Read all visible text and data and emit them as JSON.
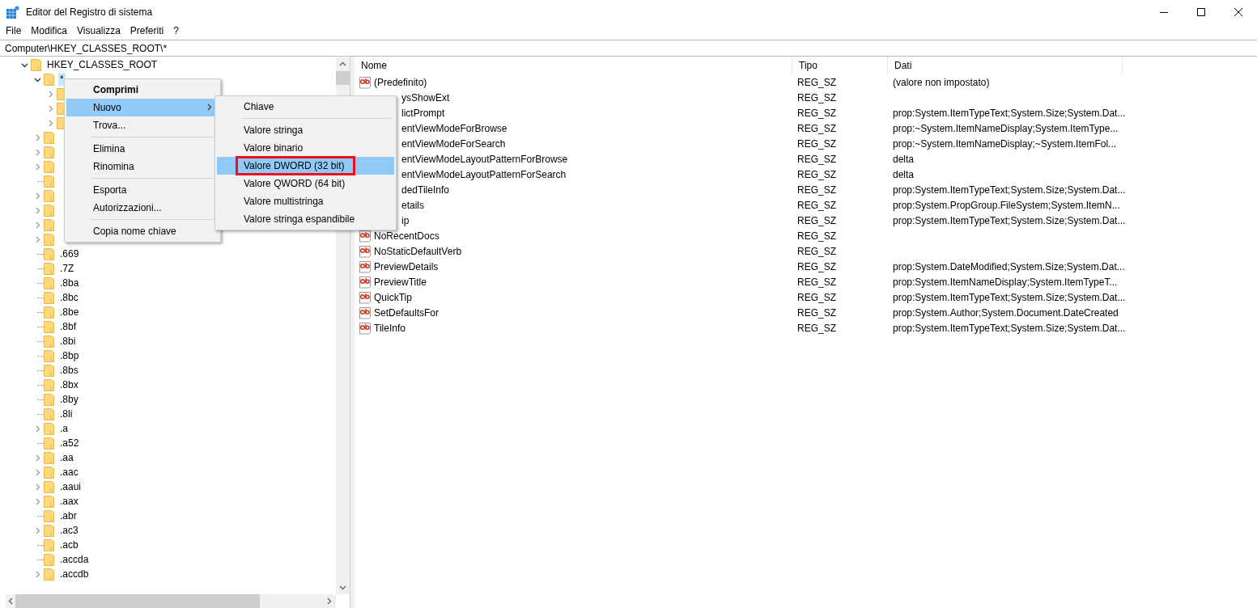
{
  "window": {
    "title": "Editor del Registro di sistema"
  },
  "menu_bar": [
    "File",
    "Modifica",
    "Visualizza",
    "Preferiti",
    "?"
  ],
  "address": {
    "value": "Computer\\HKEY_CLASSES_ROOT\\*"
  },
  "tree": [
    {
      "label": "HKEY_CLASSES_ROOT",
      "kind": "branch",
      "expanded": true,
      "selected": false,
      "children": [
        {
          "label": "*",
          "kind": "branch",
          "expanded": true,
          "selected": true,
          "children": [
            {
              "kind": "branch",
              "expanded": false,
              "selected": false
            },
            {
              "kind": "branch",
              "expanded": false,
              "selected": false
            },
            {
              "kind": "branch",
              "expanded": false,
              "selected": false
            }
          ]
        },
        {
          "kind": "branch",
          "expanded": false,
          "selected": false
        },
        {
          "kind": "branch",
          "expanded": false,
          "selected": false
        },
        {
          "kind": "branch",
          "expanded": false,
          "selected": false
        },
        {
          "kind": "leaf",
          "selected": false
        },
        {
          "kind": "branch",
          "expanded": false,
          "selected": false
        },
        {
          "kind": "branch",
          "expanded": false,
          "selected": false
        },
        {
          "kind": "branch",
          "expanded": false,
          "selected": false
        },
        {
          "kind": "branch",
          "expanded": false,
          "selected": false
        },
        {
          "label": ".669",
          "kind": "leaf",
          "selected": false
        },
        {
          "label": ".7Z",
          "kind": "leaf",
          "selected": false
        },
        {
          "label": ".8ba",
          "kind": "leaf",
          "selected": false
        },
        {
          "label": ".8bc",
          "kind": "leaf",
          "selected": false
        },
        {
          "label": ".8be",
          "kind": "leaf",
          "selected": false
        },
        {
          "label": ".8bf",
          "kind": "leaf",
          "selected": false
        },
        {
          "label": ".8bi",
          "kind": "leaf",
          "selected": false
        },
        {
          "label": ".8bp",
          "kind": "leaf",
          "selected": false
        },
        {
          "label": ".8bs",
          "kind": "leaf",
          "selected": false
        },
        {
          "label": ".8bx",
          "kind": "leaf",
          "selected": false
        },
        {
          "label": ".8by",
          "kind": "leaf",
          "selected": false
        },
        {
          "label": ".8li",
          "kind": "leaf",
          "selected": false
        },
        {
          "label": ".a",
          "kind": "branch",
          "expanded": false,
          "selected": false
        },
        {
          "label": ".a52",
          "kind": "leaf",
          "selected": false
        },
        {
          "label": ".aa",
          "kind": "branch",
          "expanded": false,
          "selected": false
        },
        {
          "label": ".aac",
          "kind": "branch",
          "expanded": false,
          "selected": false
        },
        {
          "label": ".aaui",
          "kind": "branch",
          "expanded": false,
          "selected": false
        },
        {
          "label": ".aax",
          "kind": "branch",
          "expanded": false,
          "selected": false
        },
        {
          "label": ".abr",
          "kind": "leaf",
          "selected": false
        },
        {
          "label": ".ac3",
          "kind": "branch",
          "expanded": false,
          "selected": false
        },
        {
          "label": ".acb",
          "kind": "leaf",
          "selected": false
        },
        {
          "label": ".accda",
          "kind": "leaf",
          "selected": false
        },
        {
          "label": ".accdb",
          "kind": "branch",
          "expanded": false,
          "selected": false
        }
      ]
    }
  ],
  "values": {
    "columns": [
      "Nome",
      "Tipo",
      "Dati"
    ],
    "rows": [
      {
        "kind": "string",
        "name": "(Predefinito)",
        "type": "REG_SZ",
        "data": "(valore non impostato)"
      },
      {
        "kind": "covered",
        "name": "ysShowExt",
        "type": "REG_SZ"
      },
      {
        "kind": "covered",
        "name": "lictPrompt",
        "type": "REG_SZ",
        "data": "prop:System.ItemTypeText;System.Size;System.Dat..."
      },
      {
        "kind": "covered",
        "name": "entViewModeForBrowse",
        "type": "REG_SZ",
        "data": "prop:~System.ItemNameDisplay;System.ItemType..."
      },
      {
        "kind": "covered",
        "name": "entViewModeForSearch",
        "type": "REG_SZ",
        "data": "prop:~System.ItemNameDisplay;~System.ItemFol..."
      },
      {
        "kind": "covered",
        "name": "entViewModeLayoutPatternForBrowse",
        "type": "REG_SZ",
        "data": "delta"
      },
      {
        "kind": "covered",
        "name": "entViewModeLayoutPatternForSearch",
        "type": "REG_SZ",
        "data": "delta"
      },
      {
        "kind": "covered",
        "name": "dedTileInfo",
        "type": "REG_SZ",
        "data": "prop:System.ItemTypeText;System.Size;System.Dat..."
      },
      {
        "kind": "covered",
        "name": "etails",
        "type": "REG_SZ",
        "data": "prop:System.PropGroup.FileSystem;System.ItemN..."
      },
      {
        "kind": "covered",
        "name": "ip",
        "type": "REG_SZ",
        "data": "prop:System.ItemTypeText;System.Size;System.Dat..."
      },
      {
        "kind": "string",
        "name": "NoRecentDocs",
        "type": "REG_SZ"
      },
      {
        "kind": "string",
        "name": "NoStaticDefaultVerb",
        "type": "REG_SZ"
      },
      {
        "kind": "string",
        "name": "PreviewDetails",
        "type": "REG_SZ",
        "data": "prop:System.DateModified;System.Size;System.Dat..."
      },
      {
        "kind": "string",
        "name": "PreviewTitle",
        "type": "REG_SZ",
        "data": "prop:System.ItemNameDisplay;System.ItemTypeT..."
      },
      {
        "kind": "string",
        "name": "QuickTip",
        "type": "REG_SZ",
        "data": "prop:System.ItemTypeText;System.Size;System.Dat..."
      },
      {
        "kind": "string",
        "name": "SetDefaultsFor",
        "type": "REG_SZ",
        "data": "prop:System.Author;System.Document.DateCreated"
      },
      {
        "kind": "string",
        "name": "TileInfo",
        "type": "REG_SZ",
        "data": "prop:System.ItemTypeText;System.Size;System.Dat..."
      }
    ]
  },
  "context_menu": {
    "items": [
      {
        "kind": "item",
        "label": "Comprimi",
        "bold": true,
        "selected": false,
        "submenu": false
      },
      {
        "kind": "item",
        "label": "Nuovo",
        "bold": false,
        "selected": true,
        "submenu": true
      },
      {
        "kind": "item",
        "label": "Trova...",
        "bold": false,
        "selected": false,
        "submenu": false
      },
      {
        "kind": "separator"
      },
      {
        "kind": "item",
        "label": "Elimina",
        "bold": false,
        "selected": false,
        "submenu": false
      },
      {
        "kind": "item",
        "label": "Rinomina",
        "bold": false,
        "selected": false,
        "submenu": false
      },
      {
        "kind": "separator"
      },
      {
        "kind": "item",
        "label": "Esporta",
        "bold": false,
        "selected": false,
        "submenu": false
      },
      {
        "kind": "item",
        "label": "Autorizzazioni...",
        "bold": false,
        "selected": false,
        "submenu": false
      },
      {
        "kind": "separator"
      },
      {
        "kind": "item",
        "label": "Copia nome chiave",
        "bold": false,
        "selected": false,
        "submenu": false
      }
    ]
  },
  "submenu": {
    "items": [
      {
        "kind": "item",
        "label": "Chiave",
        "selected": false,
        "outlined": false
      },
      {
        "kind": "separator"
      },
      {
        "kind": "item",
        "label": "Valore stringa",
        "selected": false,
        "outlined": false
      },
      {
        "kind": "item",
        "label": "Valore binario",
        "selected": false,
        "outlined": false
      },
      {
        "kind": "item",
        "label": "Valore DWORD (32 bit)",
        "selected": true,
        "outlined": true
      },
      {
        "kind": "item",
        "label": "Valore QWORD (64 bit)",
        "selected": false,
        "outlined": false
      },
      {
        "kind": "item",
        "label": "Valore multistringa",
        "selected": false,
        "outlined": false
      },
      {
        "kind": "item",
        "label": "Valore stringa espandibile",
        "selected": false,
        "outlined": false
      }
    ]
  }
}
